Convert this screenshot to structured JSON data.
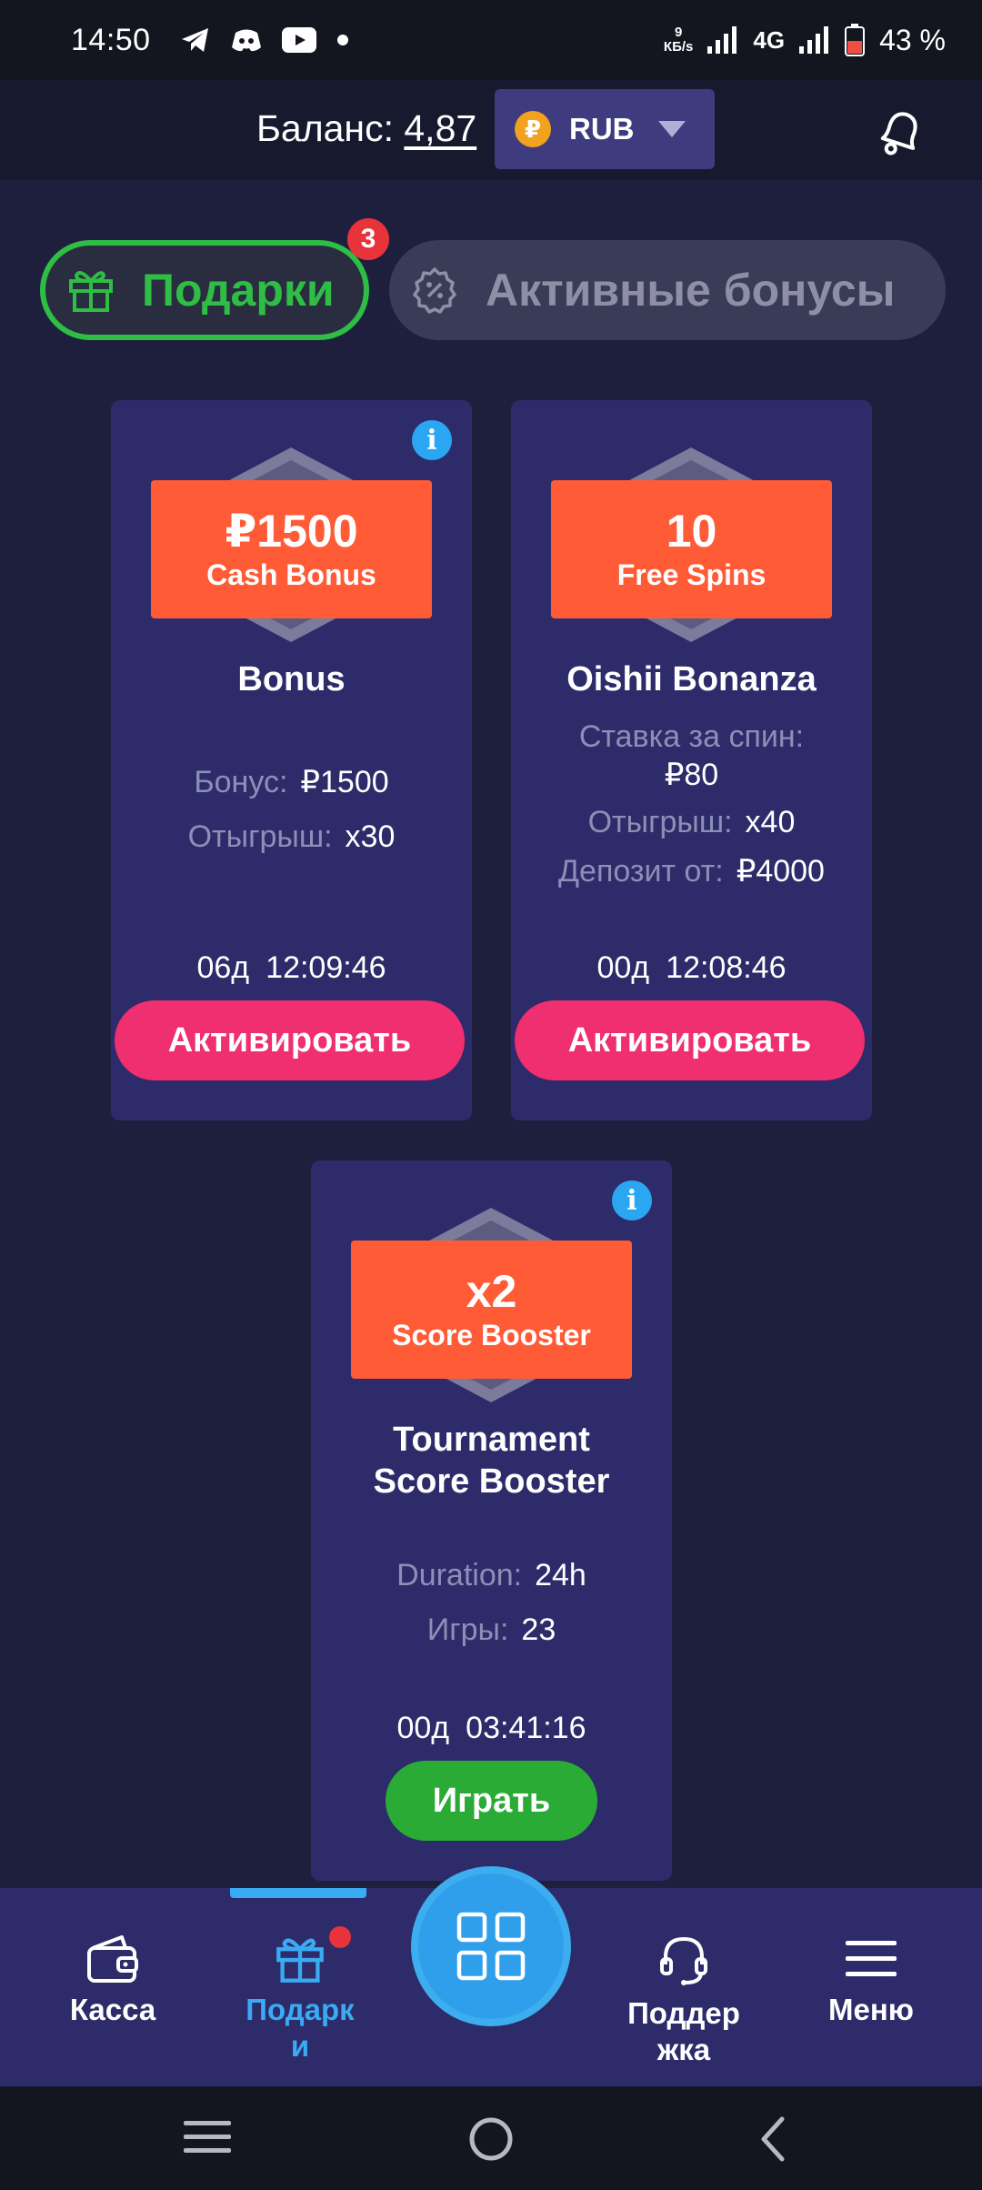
{
  "status_bar": {
    "time": "14:50",
    "speed_value": "9",
    "speed_unit": "КБ/s",
    "network": "4G",
    "battery": "43 %"
  },
  "header": {
    "balance_label": "Баланс:",
    "balance_value": "4,87",
    "currency_symbol": "₽",
    "currency_code": "RUB"
  },
  "tabs": {
    "gifts_label": "Подарки",
    "gifts_badge": "3",
    "bonuses_label": "Активные бонусы"
  },
  "cards": [
    {
      "amount": "₽1500",
      "type": "Cash Bonus",
      "title": "Bonus",
      "details": [
        {
          "key": "Бонус:",
          "value": "₽1500"
        },
        {
          "key": "Отыгрыш:",
          "value": "x30"
        }
      ],
      "timer_days": "06д",
      "timer_time": "12:09:46",
      "button": "Активировать"
    },
    {
      "amount": "10",
      "type": "Free Spins",
      "title": "Oishii Bonanza",
      "details": [
        {
          "key": "Ставка за спин:",
          "value": "₽80"
        },
        {
          "key": "Отыгрыш:",
          "value": "x40"
        },
        {
          "key": "Депозит от:",
          "value": "₽4000"
        }
      ],
      "timer_days": "00д",
      "timer_time": "12:08:46",
      "button": "Активировать"
    },
    {
      "amount": "x2",
      "type": "Score Booster",
      "title_line1": "Tournament",
      "title_line2": "Score Booster",
      "details": [
        {
          "key": "Duration:",
          "value": "24h"
        },
        {
          "key": "Игры:",
          "value": "23"
        }
      ],
      "timer_days": "00д",
      "timer_time": "03:41:16",
      "button": "Играть"
    }
  ],
  "bottom_nav": {
    "cashier": "Касса",
    "gifts_line1": "Подарк",
    "gifts_line2": "и",
    "support_line1": "Поддер",
    "support_line2": "жка",
    "menu": "Меню"
  },
  "colors": {
    "accent_green": "#2ebd45",
    "activate_pink": "#ef2f6f",
    "banner_orange": "#ff5b37",
    "nav_active_blue": "#3aaaf2",
    "card_bg": "#2d2b6a"
  },
  "icons": [
    "telegram-icon",
    "discord-icon",
    "youtube-icon",
    "signal-icon",
    "battery-icon",
    "bell-icon",
    "gift-icon",
    "bonus-badge-icon",
    "info-icon",
    "wallet-icon",
    "grid-icon",
    "headset-icon",
    "menu-icon"
  ]
}
